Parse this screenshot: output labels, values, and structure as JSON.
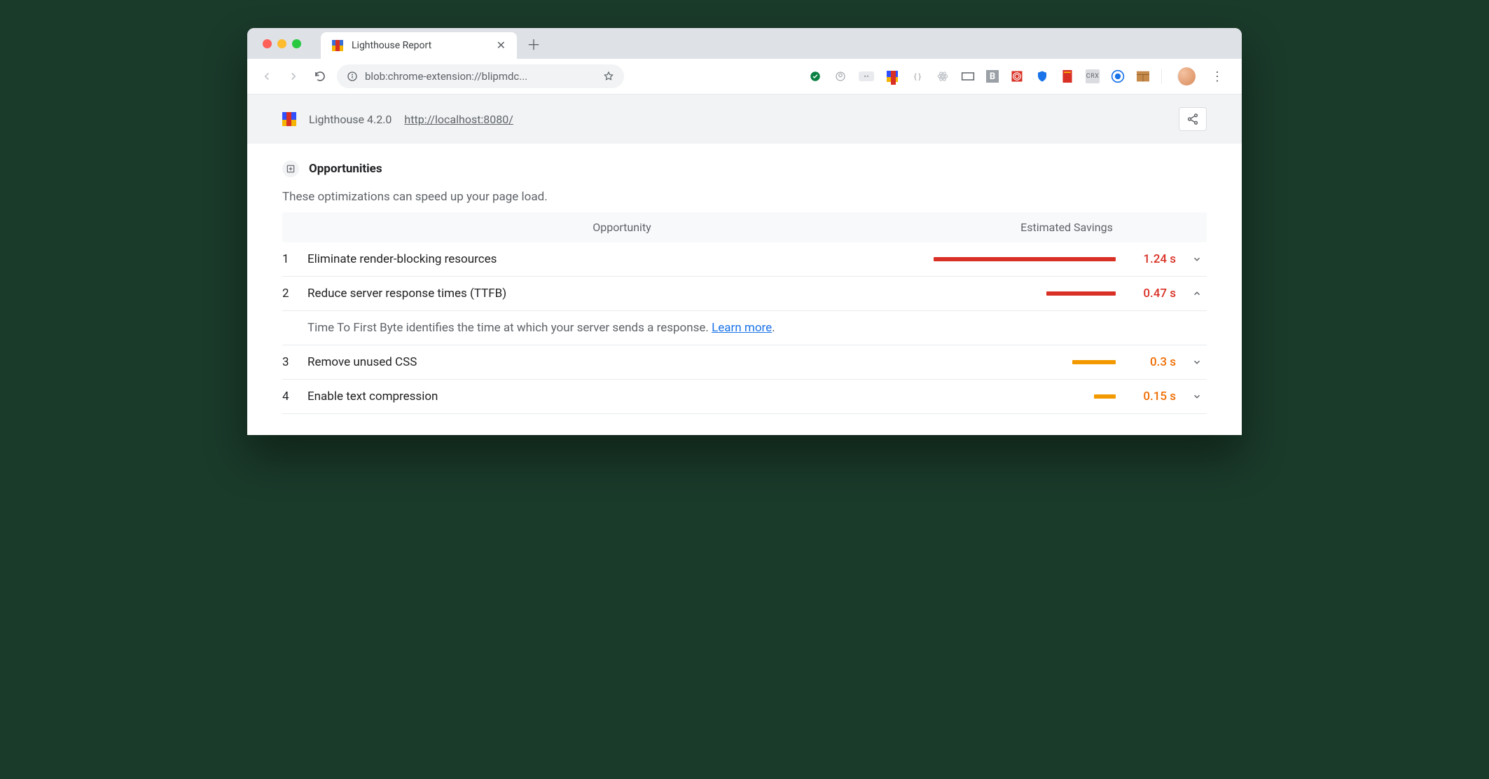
{
  "tab": {
    "title": "Lighthouse Report"
  },
  "omnibox": {
    "url": "blob:chrome-extension://blipmdc..."
  },
  "header": {
    "version": "Lighthouse 4.2.0",
    "tested_url": "http://localhost:8080/"
  },
  "section": {
    "title": "Opportunities",
    "subtitle": "These optimizations can speed up your page load."
  },
  "columns": {
    "opportunity": "Opportunity",
    "savings": "Estimated Savings"
  },
  "opportunities": [
    {
      "num": "1",
      "name": "Eliminate render-blocking resources",
      "time": "1.24 s",
      "severity": "red",
      "bar_pct": 100,
      "expanded": false
    },
    {
      "num": "2",
      "name": "Reduce server response times (TTFB)",
      "time": "0.47 s",
      "severity": "red",
      "bar_pct": 38,
      "expanded": true,
      "detail_text": "Time To First Byte identifies the time at which your server sends a response. ",
      "detail_link": "Learn more"
    },
    {
      "num": "3",
      "name": "Remove unused CSS",
      "time": "0.3 s",
      "severity": "orange",
      "bar_pct": 24,
      "expanded": false
    },
    {
      "num": "4",
      "name": "Enable text compression",
      "time": "0.15 s",
      "severity": "orange",
      "bar_pct": 12,
      "expanded": false
    }
  ]
}
